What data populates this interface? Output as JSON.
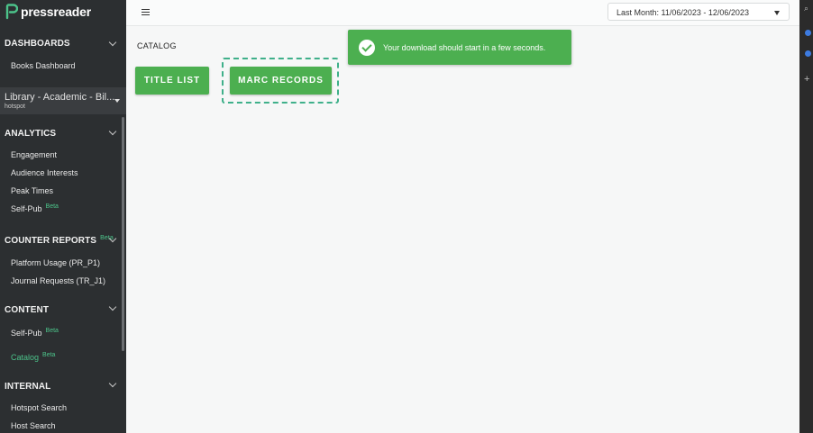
{
  "brand": {
    "name": "pressreader"
  },
  "sidebar": {
    "dashboards": {
      "title": "DASHBOARDS",
      "items": [
        "Books Dashboard"
      ]
    },
    "library": {
      "name": "Library - Academic - Bil...",
      "sub": "hotspot"
    },
    "analytics": {
      "title": "ANALYTICS",
      "items": [
        "Engagement",
        "Audience Interests",
        "Peak Times",
        "Self-Pub"
      ]
    },
    "counter": {
      "title": "COUNTER REPORTS",
      "items": [
        "Platform Usage (PR_P1)",
        "Journal Requests (TR_J1)"
      ]
    },
    "content": {
      "title": "CONTENT",
      "items": [
        "Self-Pub",
        "Catalog"
      ]
    },
    "internal": {
      "title": "INTERNAL",
      "items": [
        "Hotspot Search",
        "Host Search"
      ]
    },
    "beta_label": "Beta"
  },
  "header": {
    "date_range": "Last Month: 11/06/2023 - 12/06/2023"
  },
  "main": {
    "section_title": "CATALOG",
    "title_list_button": "TITLE LIST",
    "marc_records_button": "MARC RECORDS"
  },
  "toast": {
    "message": "Your download should start in a few seconds."
  },
  "colors": {
    "accent": "#4caf50",
    "sidebar_bg": "#2c2f31",
    "active_link": "#4cc38a"
  }
}
